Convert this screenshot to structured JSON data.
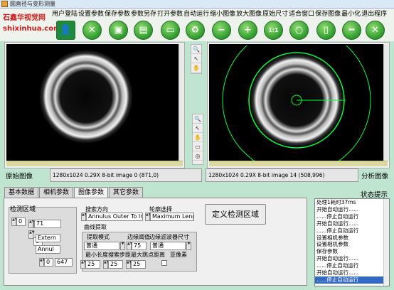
{
  "window": {
    "title": "圆直径与变形测量"
  },
  "logo": {
    "line1": "石鑫华视觉网",
    "line2": "shixinhua.com"
  },
  "menu": [
    "用户登陆",
    "设置参数",
    "保存参数",
    "参数另存",
    "打开参数",
    "自动运行",
    "缩小图像",
    "放大图像",
    "原始尺寸",
    "适合窗口",
    "保存图像",
    "最小化",
    "退出程序"
  ],
  "toolbar_icons": [
    "user-icon",
    "tools-icon",
    "save-icon",
    "save-as-icon",
    "open-icon",
    "recycle-icon",
    "zoom-out-icon",
    "zoom-in-icon",
    "actual-size-icon",
    "fit-window-icon",
    "save-image-icon",
    "minimize-icon",
    "close-icon"
  ],
  "left_image": {
    "label": "原始图像",
    "status": "1280x1024 0.29X 8-bit image 0     (871,0)"
  },
  "right_image": {
    "label": "分析图像",
    "status": "1280x1024 0.29X 8-bit image 14     (508,996)"
  },
  "tabs": [
    "基本数据",
    "相机参数",
    "图像参数",
    "其它参数"
  ],
  "active_tab": "图像参数",
  "detect_area": {
    "title": "检测区域",
    "index_a": "0",
    "index_b": "0",
    "value_top": "71",
    "shape_1": "Extern",
    "shape_2": "Annul",
    "index_c": "0",
    "value_bottom": "647"
  },
  "search": {
    "direction_label": "搜索方向",
    "direction_value": "Annulus Outer To Inner",
    "contour_label": "轮廓选择",
    "contour_value": "Maximum Length",
    "curve_label": "曲线提取",
    "mode_label": "提取模式",
    "mode_value": "普通",
    "threshold_label": "边缘阈值",
    "threshold_value": "75",
    "filter_label": "边缘滤波器尺寸",
    "filter_value": "普通",
    "min_len_label": "最小长度",
    "min_len_value": "25",
    "step_label": "搜索步距",
    "step_value": "25",
    "max_jump_label": "最大跳点距离",
    "max_jump_value": "25",
    "subpixel_label": "亚像素"
  },
  "define_button": "定义检测区域",
  "log": {
    "title": "状态提示",
    "items": [
      "处理1耗时37ms",
      "开始自动运行......",
      "......停止自动运行",
      "开始自动运行......",
      "......停止自动运行",
      "设置相机参数",
      "设置相机参数",
      "保存参数",
      "开始自动运行......",
      "......停止自动运行",
      "开始自动运行......",
      "......停止自动运行"
    ]
  },
  "colors": {
    "background": "#bfe4cf",
    "accent_green": "#2d9a2d",
    "overlay_green": "#00ff3c",
    "log_selected": "#3169c6"
  }
}
